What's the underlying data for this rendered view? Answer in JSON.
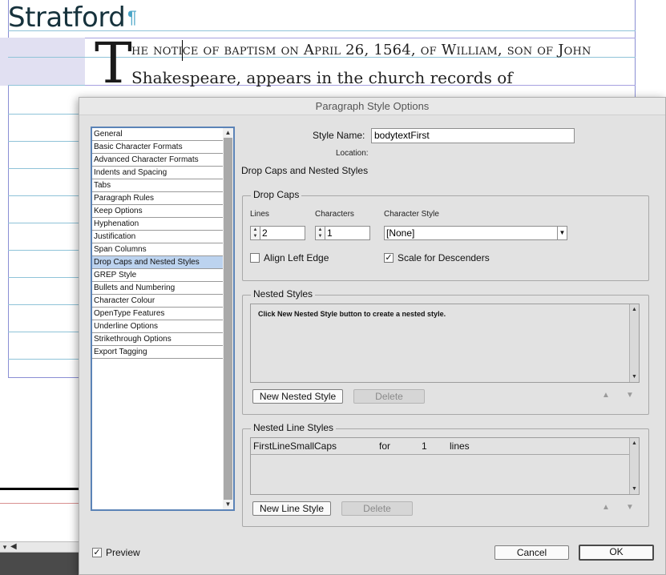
{
  "document": {
    "heading": "Stratford",
    "pilcrow": "¶",
    "drop_cap": "T",
    "line1": "he notice of baptism on April 26, 1564, of William, son of John",
    "line2": "Shakespeare, appears in the church records of",
    "scroll_dropdown_glyph": "▾",
    "scroll_left_glyph": "◀"
  },
  "dialog": {
    "title": "Paragraph Style Options",
    "categories": [
      "General",
      "Basic Character Formats",
      "Advanced Character Formats",
      "Indents and Spacing",
      "Tabs",
      "Paragraph Rules",
      "Keep Options",
      "Hyphenation",
      "Justification",
      "Span Columns",
      "Drop Caps and Nested Styles",
      "GREP Style",
      "Bullets and Numbering",
      "Character Colour",
      "OpenType Features",
      "Underline Options",
      "Strikethrough Options",
      "Export Tagging"
    ],
    "selected_category": "Drop Caps and Nested Styles",
    "style_name_label": "Style Name:",
    "style_name_value": "bodytextFirst",
    "location_label": "Location:",
    "section_title": "Drop Caps and Nested Styles",
    "drop_caps": {
      "title": "Drop Caps",
      "lines_label": "Lines",
      "lines_value": "2",
      "characters_label": "Characters",
      "characters_value": "1",
      "char_style_label": "Character Style",
      "char_style_value": "[None]",
      "align_left_edge_label": "Align Left Edge",
      "align_left_edge_checked": false,
      "scale_descenders_label": "Scale for Descenders",
      "scale_descenders_checked": true
    },
    "nested_styles": {
      "title": "Nested Styles",
      "hint": "Click New Nested Style button to create a nested style.",
      "new_button": "New Nested Style",
      "delete_button": "Delete"
    },
    "nested_line_styles": {
      "title": "Nested Line Styles",
      "rows": [
        {
          "style": "FirstLineSmallCaps",
          "for": "for",
          "count": "1",
          "unit": "lines"
        }
      ],
      "new_button": "New Line Style",
      "delete_button": "Delete"
    },
    "preview_label": "Preview",
    "preview_checked": true,
    "cancel_button": "Cancel",
    "ok_button": "OK"
  },
  "glyphs": {
    "check": "✓",
    "up": "▲",
    "down": "▼",
    "spin": "▲▼"
  },
  "colors": {
    "selection": "#bcd3ef",
    "list_border": "#5b83b7",
    "guide": "#8fc3d8",
    "frame": "#8a8fd4"
  }
}
